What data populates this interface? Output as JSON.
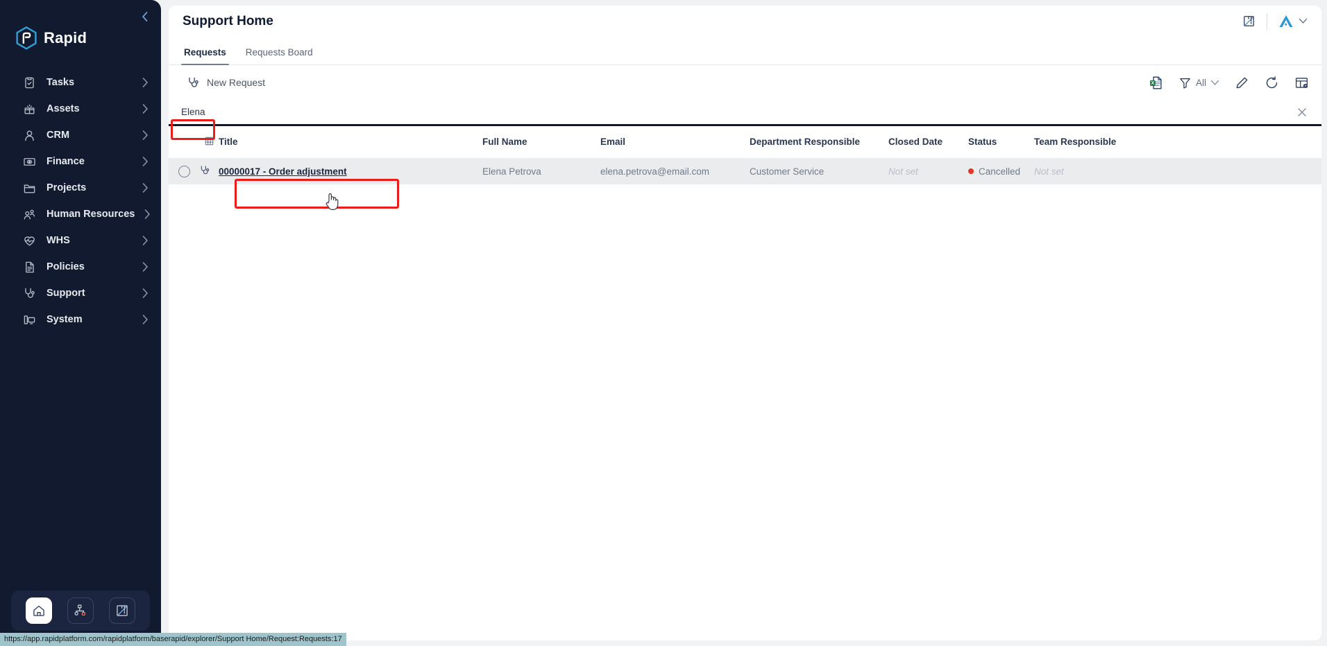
{
  "brand": {
    "name": "Rapid",
    "logo_icon": "rapid-hexagon-logo-icon",
    "collapse_icon": "chevron-left-icon"
  },
  "sidebar": {
    "items": [
      {
        "label": "Tasks",
        "icon": "clipboard-check-icon"
      },
      {
        "label": "Assets",
        "icon": "assets-box-icon"
      },
      {
        "label": "CRM",
        "icon": "person-icon"
      },
      {
        "label": "Finance",
        "icon": "banknote-eye-icon"
      },
      {
        "label": "Projects",
        "icon": "folder-icon"
      },
      {
        "label": "Human Resources",
        "icon": "people-icon"
      },
      {
        "label": "WHS",
        "icon": "heart-pulse-icon"
      },
      {
        "label": "Policies",
        "icon": "document-lines-icon"
      },
      {
        "label": "Support",
        "icon": "stethoscope-icon"
      },
      {
        "label": "System",
        "icon": "computer-icon"
      }
    ],
    "chevron_icon": "chevron-right-icon",
    "footer_buttons": [
      {
        "icon": "home-icon",
        "active": true
      },
      {
        "icon": "sitemap-icon",
        "active": false
      },
      {
        "icon": "ruler-icon",
        "active": false
      }
    ]
  },
  "header": {
    "title": "Support Home",
    "ruler_icon": "ruler-icon",
    "avatar_icon": "avatar-logo-icon",
    "avatar_chevron_icon": "chevron-down-icon"
  },
  "tabs": [
    {
      "label": "Requests",
      "active": true
    },
    {
      "label": "Requests Board",
      "active": false
    }
  ],
  "toolbar": {
    "new_request_label": "New Request",
    "new_request_icon": "stethoscope-icon",
    "excel_export_icon": "excel-export-icon",
    "filter_icon": "funnel-icon",
    "filter_label": "All",
    "filter_chevron_icon": "chevron-down-icon",
    "edit_icon": "pencil-icon",
    "refresh_icon": "refresh-icon",
    "columns_icon": "table-settings-icon"
  },
  "search": {
    "value": "Elena",
    "placeholder": "",
    "clear_icon": "close-x-icon"
  },
  "table": {
    "grid_icon": "grid-icon",
    "columns": [
      "Title",
      "Full Name",
      "Email",
      "Department Responsible",
      "Closed Date",
      "Status",
      "Team Responsible"
    ],
    "rows": [
      {
        "row_icon": "stethoscope-icon",
        "title": "00000017 - Order adjustment",
        "full_name": "Elena Petrova",
        "email": "elena.petrova@email.com",
        "department": "Customer Service",
        "closed_date": "Not set",
        "status": "Cancelled",
        "status_color": "#e8352a",
        "team": "Not set"
      }
    ]
  },
  "statusbar": {
    "url": "https://app.rapidplatform.com/rapidplatform/baserapid/explorer/Support Home/Request:Requests:17"
  },
  "colors": {
    "sidebar_bg": "#111a2e",
    "accent_blue": "#2f9fd6",
    "annotation_red": "#ee1b1b",
    "row_bg": "#ebecee"
  }
}
